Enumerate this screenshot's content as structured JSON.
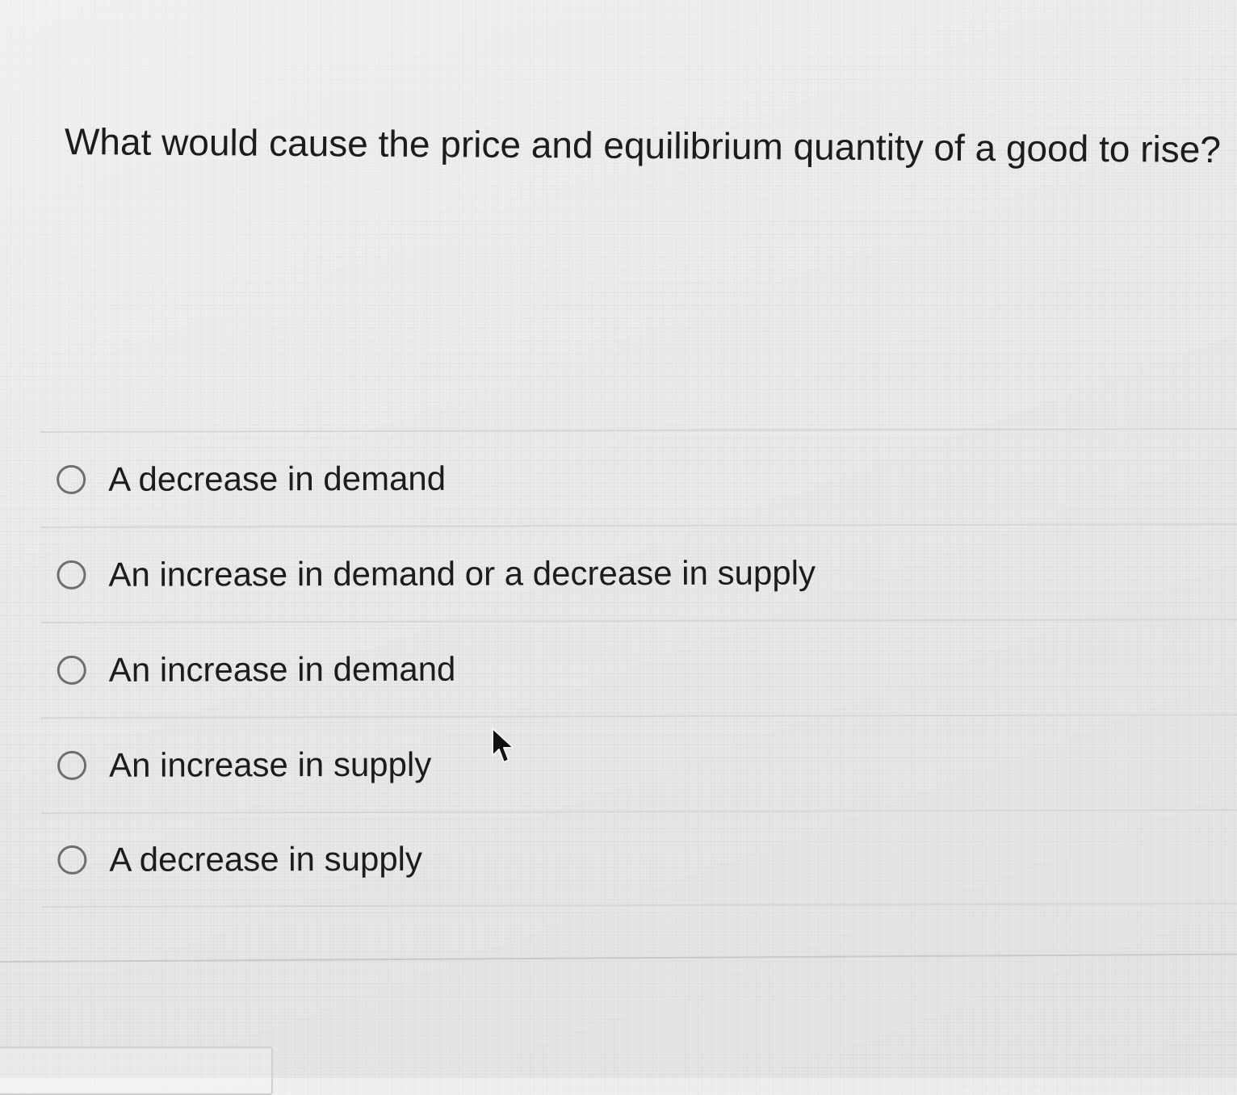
{
  "question": {
    "text": "What would cause the price and equilibrium quantity of a good to rise?"
  },
  "choices": [
    {
      "label": "A decrease in demand",
      "selected": false
    },
    {
      "label": "An increase in demand or a decrease in supply",
      "selected": false
    },
    {
      "label": "An increase in demand",
      "selected": false
    },
    {
      "label": "An increase in supply",
      "selected": false
    },
    {
      "label": "A decrease in supply",
      "selected": false
    }
  ],
  "icons": {
    "radio": "radio-unchecked-icon",
    "cursor": "mouse-pointer-icon"
  },
  "colors": {
    "text": "#1c1c1e",
    "radio_border": "#6e6e70",
    "divider": "#d6d6d4",
    "background": "#ebebea"
  }
}
